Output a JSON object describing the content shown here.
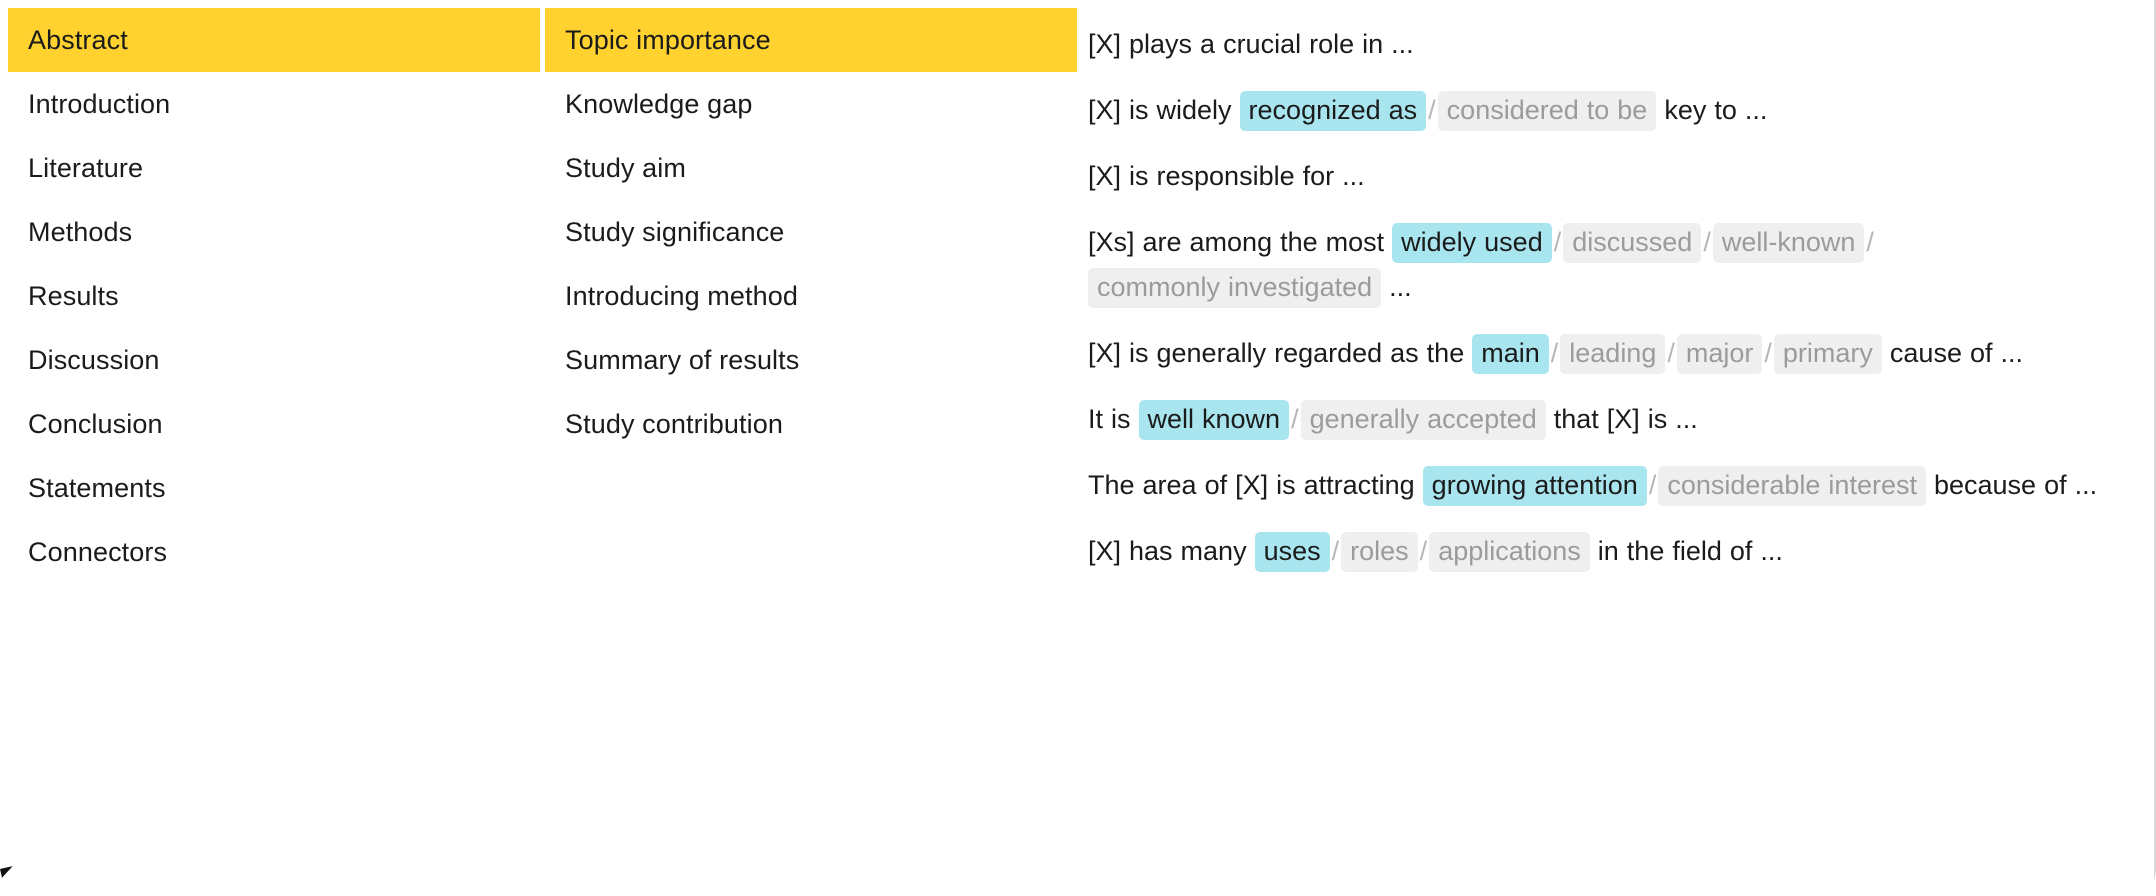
{
  "colors": {
    "accent_yellow": "#ffd230",
    "highlight_primary": "#a9e5ef",
    "highlight_alt": "#efefef",
    "alt_text": "#9b9b9b",
    "text": "#1b1b1b"
  },
  "nav": {
    "sections": [
      {
        "label": "Abstract",
        "active": true
      },
      {
        "label": "Introduction",
        "active": false
      },
      {
        "label": "Literature",
        "active": false
      },
      {
        "label": "Methods",
        "active": false
      },
      {
        "label": "Results",
        "active": false
      },
      {
        "label": "Discussion",
        "active": false
      },
      {
        "label": "Conclusion",
        "active": false
      },
      {
        "label": "Statements",
        "active": false
      },
      {
        "label": "Connectors",
        "active": false
      }
    ],
    "moves": [
      {
        "label": "Topic importance",
        "active": true
      },
      {
        "label": "Knowledge gap",
        "active": false
      },
      {
        "label": "Study aim",
        "active": false
      },
      {
        "label": "Study significance",
        "active": false
      },
      {
        "label": "Introducing method",
        "active": false
      },
      {
        "label": "Summary of results",
        "active": false
      },
      {
        "label": "Study contribution",
        "active": false
      }
    ]
  },
  "phrases": [
    {
      "parts": [
        {
          "type": "text",
          "value": "[X] plays a crucial role in ..."
        }
      ]
    },
    {
      "parts": [
        {
          "type": "text",
          "value": "[X] is widely "
        },
        {
          "type": "primary",
          "value": "recognized as"
        },
        {
          "type": "sep",
          "value": "/"
        },
        {
          "type": "alt",
          "value": "considered to be"
        },
        {
          "type": "text",
          "value": " key to ..."
        }
      ]
    },
    {
      "parts": [
        {
          "type": "text",
          "value": "[X] is responsible for ..."
        }
      ]
    },
    {
      "parts": [
        {
          "type": "text",
          "value": "[Xs] are among the most "
        },
        {
          "type": "primary",
          "value": "widely used"
        },
        {
          "type": "sep",
          "value": "/"
        },
        {
          "type": "alt",
          "value": "discussed"
        },
        {
          "type": "sep",
          "value": "/"
        },
        {
          "type": "alt",
          "value": "well-known"
        },
        {
          "type": "sep",
          "value": "/"
        },
        {
          "type": "alt",
          "value": "commonly investigated"
        },
        {
          "type": "text",
          "value": " ..."
        }
      ]
    },
    {
      "parts": [
        {
          "type": "text",
          "value": "[X] is generally regarded as the "
        },
        {
          "type": "primary",
          "value": "main"
        },
        {
          "type": "sep",
          "value": "/"
        },
        {
          "type": "alt",
          "value": "leading"
        },
        {
          "type": "sep",
          "value": "/"
        },
        {
          "type": "alt",
          "value": "major"
        },
        {
          "type": "sep",
          "value": "/"
        },
        {
          "type": "alt",
          "value": "primary"
        },
        {
          "type": "text",
          "value": " cause of ..."
        }
      ]
    },
    {
      "parts": [
        {
          "type": "text",
          "value": "It is "
        },
        {
          "type": "primary",
          "value": "well known"
        },
        {
          "type": "sep",
          "value": "/"
        },
        {
          "type": "alt",
          "value": "generally accepted"
        },
        {
          "type": "text",
          "value": " that [X] is ..."
        }
      ]
    },
    {
      "parts": [
        {
          "type": "text",
          "value": "The area of [X] is attracting "
        },
        {
          "type": "primary",
          "value": "growing attention"
        },
        {
          "type": "sep",
          "value": "/"
        },
        {
          "type": "alt",
          "value": "considerable interest"
        },
        {
          "type": "text",
          "value": " because of ..."
        }
      ]
    },
    {
      "parts": [
        {
          "type": "text",
          "value": "[X] has many "
        },
        {
          "type": "primary",
          "value": "uses"
        },
        {
          "type": "sep",
          "value": "/"
        },
        {
          "type": "alt",
          "value": "roles"
        },
        {
          "type": "sep",
          "value": "/"
        },
        {
          "type": "alt",
          "value": "applications"
        },
        {
          "type": "text",
          "value": " in the field of ..."
        }
      ]
    }
  ]
}
